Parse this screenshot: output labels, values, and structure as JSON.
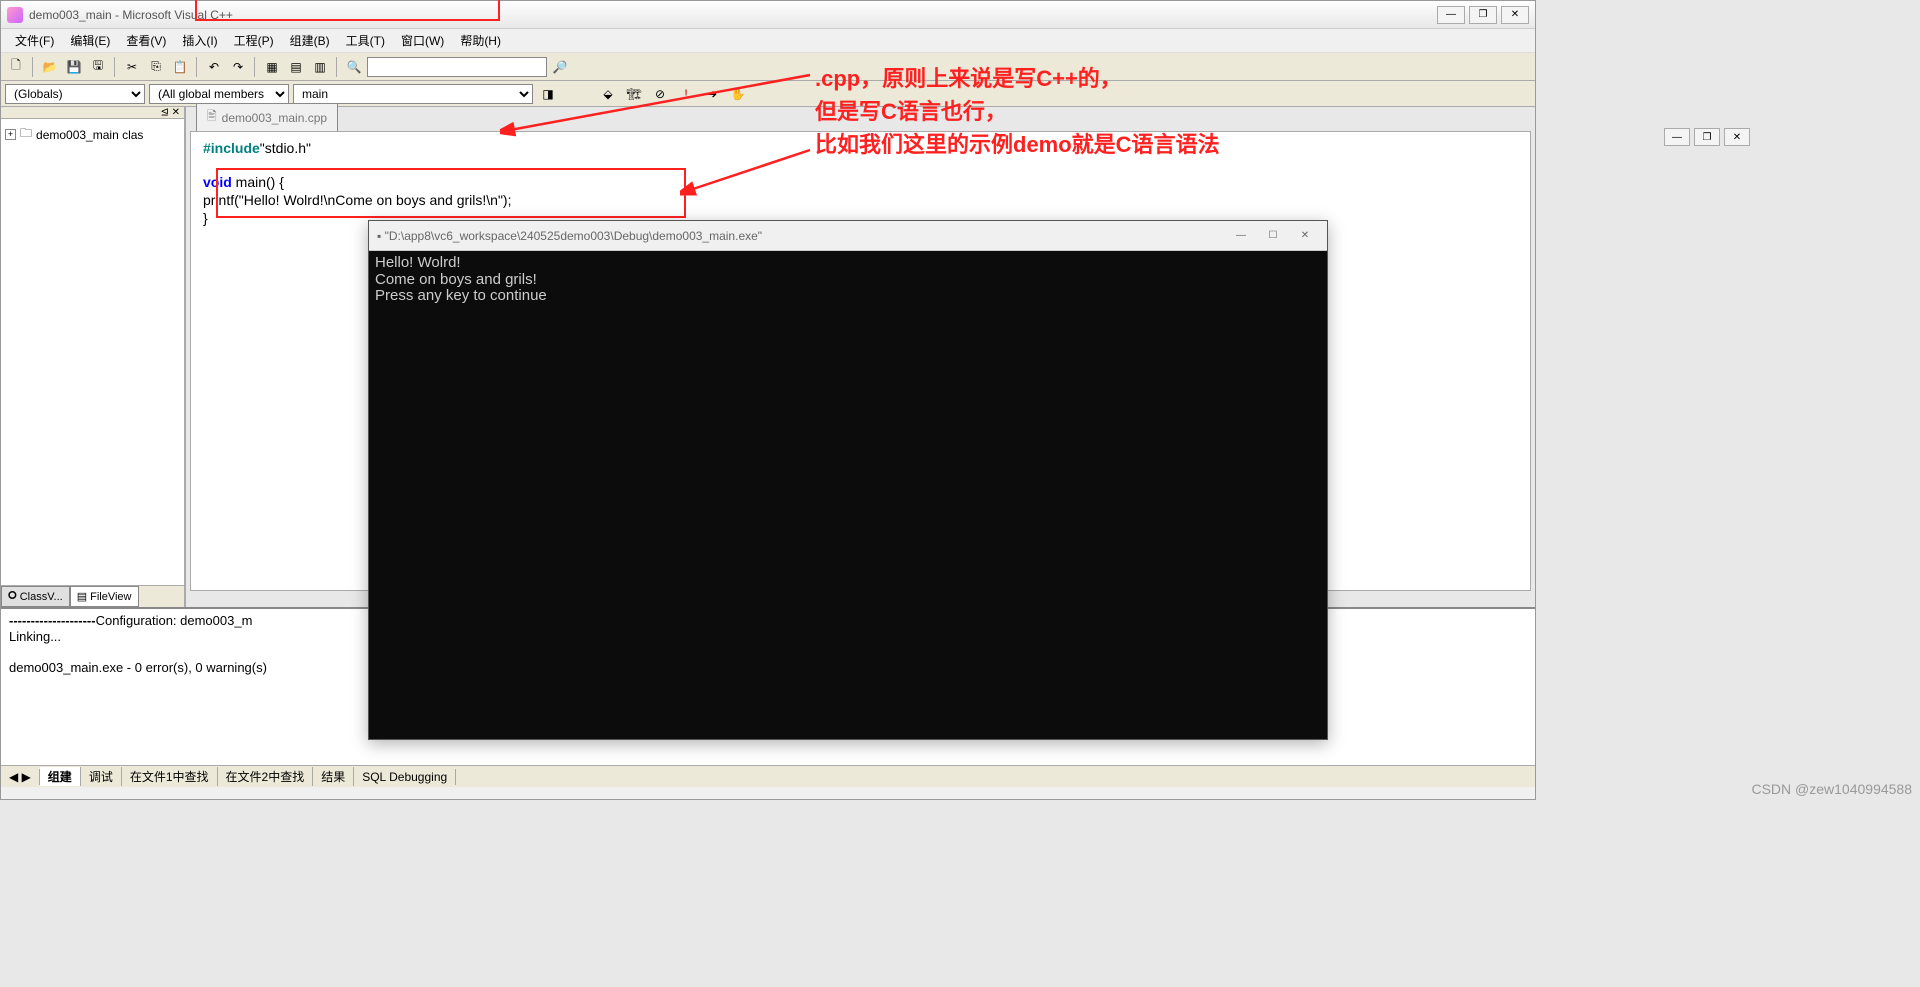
{
  "window": {
    "title": "demo003_main - Microsoft Visual C++",
    "min": "—",
    "max": "❐",
    "close": "✕"
  },
  "menu": {
    "file": "文件(F)",
    "edit": "编辑(E)",
    "view": "查看(V)",
    "insert": "插入(I)",
    "project": "工程(P)",
    "build": "组建(B)",
    "tools": "工具(T)",
    "window": "窗口(W)",
    "help": "帮助(H)"
  },
  "classbar": {
    "globals": "(Globals)",
    "members": "(All global members",
    "func": "main"
  },
  "tree": {
    "root": "demo003_main clas"
  },
  "sidebar_tabs": {
    "classview": "ClassV...",
    "fileview": "FileView"
  },
  "editor": {
    "tab_name": "demo003_main.cpp",
    "code": {
      "l1a": "#include",
      "l1b": "\"stdio.h\"",
      "l2a": "void",
      "l2b": " main() {",
      "l3": "    printf(\"Hello! Wolrd!\\nCome on boys and grils!\\n\");",
      "l4": "}"
    }
  },
  "mdi": {
    "min": "—",
    "max": "❐",
    "close": "✕"
  },
  "output": {
    "dash": "--------------------",
    "config": "Configuration: demo003_m",
    "linking": "Linking...",
    "result": "demo003_main.exe - 0 error(s), 0 warning(s)",
    "tabs": {
      "nav": "◀ ▶",
      "build": "组建",
      "debug": "调试",
      "find1": "在文件1中查找",
      "find2": "在文件2中查找",
      "results": "结果",
      "sql": "SQL Debugging"
    }
  },
  "console": {
    "title": "\"D:\\app8\\vc6_workspace\\240525demo003\\Debug\\demo003_main.exe\"",
    "l1": "Hello! Wolrd!",
    "l2": "Come on boys and grils!",
    "l3": "Press any key to continue",
    "min": "—",
    "max": "☐",
    "close": "✕"
  },
  "annotation": {
    "l1": ".cpp，原则上来说是写C++的，",
    "l2": "但是写C语言也行，",
    "l3": "比如我们这里的示例demo就是C语言语法"
  },
  "watermark": "CSDN @zew1040994588"
}
